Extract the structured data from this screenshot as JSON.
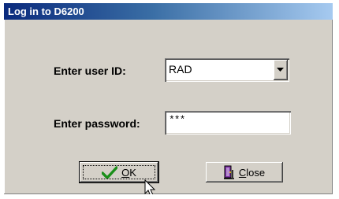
{
  "window": {
    "title": "Log in to D6200"
  },
  "form": {
    "user_id_label": "Enter user ID:",
    "user_id_value": "RAD",
    "password_label": "Enter password:",
    "password_value": "***"
  },
  "buttons": {
    "ok_mnemonic": "O",
    "ok_rest": "K",
    "close_mnemonic": "C",
    "close_rest": "lose"
  },
  "icons": {
    "ok": "checkmark-icon",
    "close": "door-exit-icon",
    "dropdown": "chevron-down-icon",
    "cursor": "mouse-pointer-icon"
  },
  "colors": {
    "titlebar_start": "#0a2a7d",
    "titlebar_end": "#a6caf0",
    "dialog_bg": "#d4d0c8",
    "check_green": "#1a8f1a"
  }
}
